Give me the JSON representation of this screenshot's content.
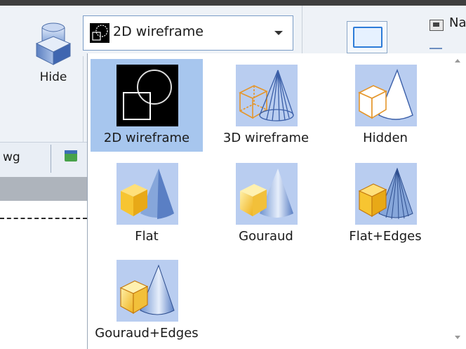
{
  "ribbon": {
    "hide_label": "Hide",
    "right_label_partial": "Na"
  },
  "combo": {
    "selected": "2D wireframe",
    "icon": "wireframe-2d-icon"
  },
  "file_tabs": {
    "tab_label": "wg",
    "tab_icon": "dwg-file-icon"
  },
  "visual_styles": {
    "items": [
      {
        "label": "2D wireframe",
        "icon": "wireframe-2d-icon",
        "selected": true
      },
      {
        "label": "3D wireframe",
        "icon": "wireframe-3d-icon"
      },
      {
        "label": "Hidden",
        "icon": "hidden-style-icon"
      },
      {
        "label": "Flat",
        "icon": "flat-style-icon"
      },
      {
        "label": "Gouraud",
        "icon": "gouraud-style-icon"
      },
      {
        "label": "Flat+Edges",
        "icon": "flat-edges-style-icon"
      },
      {
        "label": "Gouraud+Edges",
        "icon": "gouraud-edges-style-icon"
      }
    ]
  },
  "colors": {
    "selection": "#a7c6ee",
    "icon_bg": "#b9cdf0",
    "accent": "#2d7cd8"
  }
}
